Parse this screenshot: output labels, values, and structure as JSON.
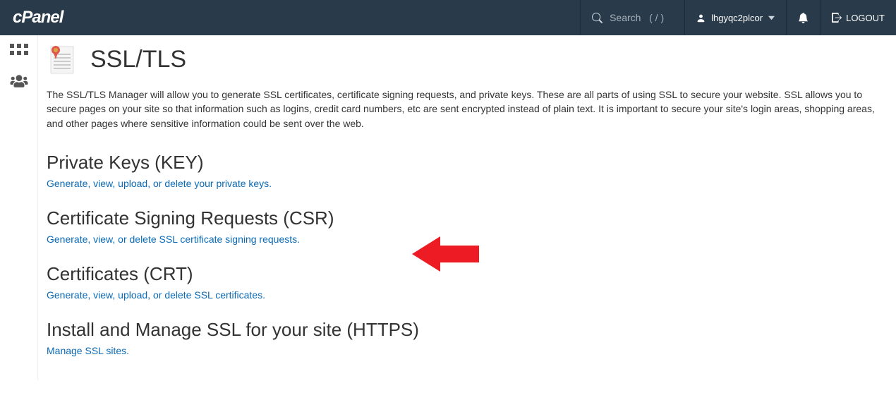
{
  "topbar": {
    "logo_text": "cPanel",
    "search_placeholder": "Search   ( / )",
    "username": "lhgyqc2plcor",
    "logout_label": "LOGOUT"
  },
  "page": {
    "title": "SSL/TLS",
    "intro": "The SSL/TLS Manager will allow you to generate SSL certificates, certificate signing requests, and private keys. These are all parts of using SSL to secure your website. SSL allows you to secure pages on your site so that information such as logins, credit card numbers, etc are sent encrypted instead of plain text. It is important to secure your site's login areas, shopping areas, and other pages where sensitive information could be sent over the web."
  },
  "sections": {
    "key": {
      "heading": "Private Keys (KEY)",
      "link": "Generate, view, upload, or delete your private keys."
    },
    "csr": {
      "heading": "Certificate Signing Requests (CSR)",
      "link": "Generate, view, or delete SSL certificate signing requests."
    },
    "crt": {
      "heading": "Certificates (CRT)",
      "link": "Generate, view, upload, or delete SSL certificates."
    },
    "https": {
      "heading": "Install and Manage SSL for your site (HTTPS)",
      "link": "Manage SSL sites."
    }
  }
}
